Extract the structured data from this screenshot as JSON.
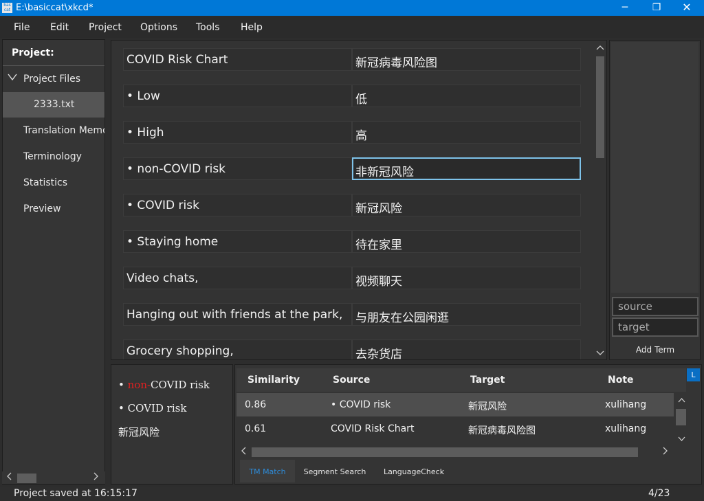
{
  "window": {
    "title": "E:\\basiccat\\xkcd*",
    "app_icon_text": "bas cat",
    "minimize_glyph": "─",
    "maximize_glyph": "❐",
    "close_glyph": "✕"
  },
  "menu": [
    "File",
    "Edit",
    "Project",
    "Options",
    "Tools",
    "Help"
  ],
  "sidebar": {
    "title": "Project:",
    "items": [
      {
        "label": "Project Files",
        "expanded": true
      },
      {
        "label": "2333.txt",
        "selected": true
      },
      {
        "label": "Translation Memory"
      },
      {
        "label": "Terminology"
      },
      {
        "label": "Statistics"
      },
      {
        "label": "Preview"
      }
    ]
  },
  "segments": [
    {
      "source": "COVID Risk Chart",
      "target": "新冠病毒风险图"
    },
    {
      "source": "• Low",
      "target": "低"
    },
    {
      "source": "• High",
      "target": "高"
    },
    {
      "source": "• non-COVID risk",
      "target": "非新冠风险",
      "active": true
    },
    {
      "source": "• COVID risk",
      "target": "新冠风险"
    },
    {
      "source": "• Staying home",
      "target": "待在家里"
    },
    {
      "source": "Video chats,",
      "target": "视频聊天"
    },
    {
      "source": "Hanging out with friends at the park,",
      "target": "与朋友在公园闲逛"
    },
    {
      "source": "Grocery shopping,",
      "target": "去杂货店"
    }
  ],
  "term_panel": {
    "source_placeholder": "source",
    "target_placeholder": "target",
    "add_button": "Add Term"
  },
  "diff": {
    "line1_prefix": "• ",
    "line1_deleted": "non-",
    "line1_rest": "COVID risk",
    "line2": "• COVID risk",
    "line3": "新冠风险"
  },
  "tm": {
    "columns": [
      "Similarity",
      "Source",
      "Target",
      "Note"
    ],
    "rows": [
      {
        "similarity": "0.86",
        "source": "• COVID risk",
        "target": "新冠风险",
        "note": "xulihang",
        "selected": true
      },
      {
        "similarity": "0.61",
        "source": "COVID Risk Chart",
        "target": "新冠病毒风险图",
        "note": "xulihang"
      }
    ],
    "tabs": [
      "TM Match",
      "Segment Search",
      "LanguageCheck"
    ],
    "active_tab": "TM Match",
    "corner_label": "L"
  },
  "status": {
    "message": "Project saved at 16:15:17",
    "position": "4/23"
  },
  "colors": {
    "accent": "#0078d7",
    "active_border": "#7ec3ea",
    "deleted_text": "#e02020",
    "active_tab_text": "#2e8bd8"
  },
  "icons": {
    "tree_expand": "chevron-down-icon",
    "scroll_up": "arrow-up-icon",
    "scroll_down": "arrow-down-icon",
    "scroll_left": "arrow-left-icon",
    "scroll_right": "arrow-right-icon"
  }
}
